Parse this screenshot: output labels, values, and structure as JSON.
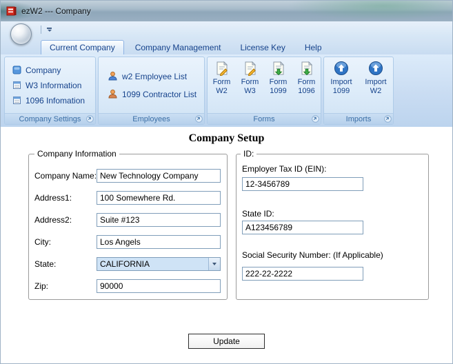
{
  "window": {
    "title": "ezW2 --- Company"
  },
  "colors": {
    "ribbon_text": "#15428b",
    "group_label_text": "#3a6ea5",
    "logo_red": "#d42b1e",
    "input_border": "#7f9db9",
    "ribbon_background": "#cfe1f4"
  },
  "icons": {
    "app": "ezw2-logo-icon",
    "application_menu": "orb-icon",
    "company": "company-icon",
    "w3_information": "form-window-icon",
    "info_1096": "form-window-icon",
    "employee": "person-icon",
    "contractor": "person-icon",
    "form_w2": "form-pencil-icon",
    "form_w3": "form-pencil-icon",
    "form_1099": "form-green-arrow-icon",
    "form_1096": "form-green-arrow-icon",
    "import": "blue-circle-up-arrow-icon",
    "group_launcher": "dialog-launcher-icon",
    "combo_arrow": "chevron-down-icon"
  },
  "tabs": {
    "current_company": "Current Company",
    "company_management": "Company Management",
    "license_key": "License Key",
    "help": "Help"
  },
  "ribbon": {
    "company_settings": {
      "label": "Company Settings",
      "items": {
        "company": "Company",
        "w3": "W3 Information",
        "i1096": "1096 Infomation"
      }
    },
    "employees": {
      "label": "Employees",
      "items": {
        "w2_list": "w2 Employee List",
        "c1099_list": "1099 Contractor List"
      }
    },
    "forms": {
      "label": "Forms",
      "items": [
        {
          "line1": "Form",
          "line2": "W2"
        },
        {
          "line1": "Form",
          "line2": "W3"
        },
        {
          "line1": "Form",
          "line2": "1099"
        },
        {
          "line1": "Form",
          "line2": "1096"
        }
      ]
    },
    "imports": {
      "label": "Imports",
      "items": [
        {
          "line1": "Import",
          "line2": "1099"
        },
        {
          "line1": "Import",
          "line2": "W2"
        }
      ]
    }
  },
  "main": {
    "title": "Company Setup",
    "company_information": {
      "legend": "Company Information",
      "company_name": {
        "label": "Company Name:",
        "value": "New Technology Company"
      },
      "address1": {
        "label": "Address1:",
        "value": "100 Somewhere Rd."
      },
      "address2": {
        "label": "Address2:",
        "value": "Suite #123"
      },
      "city": {
        "label": "City:",
        "value": "Los Angels"
      },
      "state": {
        "label": "State:",
        "value": "CALIFORNIA"
      },
      "zip": {
        "label": "Zip:",
        "value": "90000"
      }
    },
    "id_section": {
      "legend": "ID:",
      "ein": {
        "label": "Employer Tax ID (EIN):",
        "value": "12-3456789"
      },
      "state_id": {
        "label": "State ID:",
        "value": "A123456789"
      },
      "ssn": {
        "label": "Social Security Number: (If Applicable)",
        "value": "222-22-2222"
      }
    },
    "update_button": "Update"
  }
}
